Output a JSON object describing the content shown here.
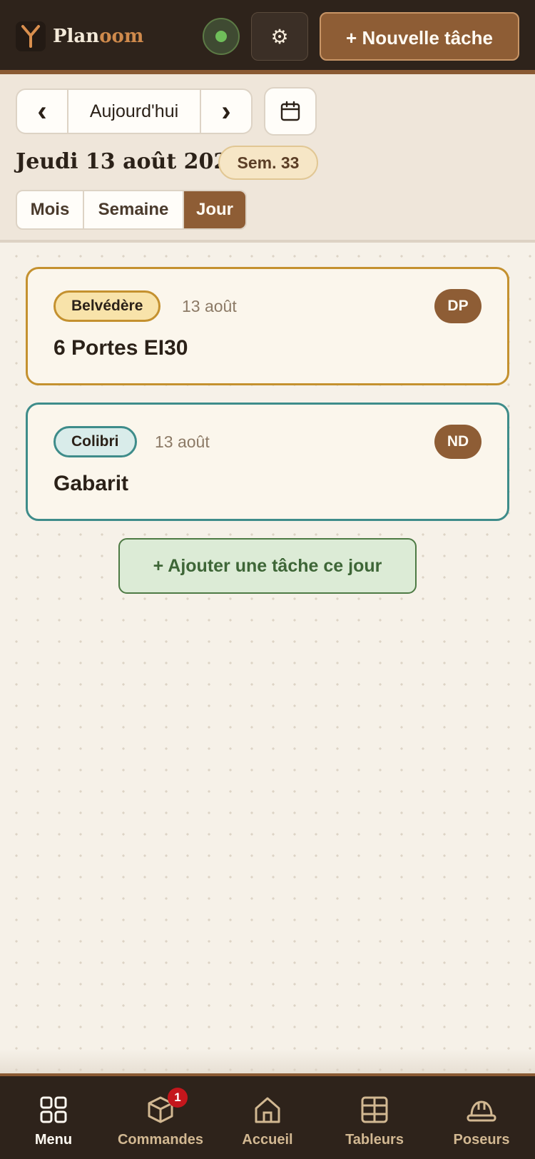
{
  "colors": {
    "brand": "#8e5d35",
    "topbar": "#2e231b",
    "status_ok": "#6fbe5a",
    "tag_belvedere": "#c4912f",
    "tag_colibri": "#3e8c8a",
    "add_task": "#4d7a44",
    "badge": "#c4161c"
  },
  "header": {
    "logo_icon": "y-fork-logo-icon",
    "logo_part1": "Plan",
    "logo_part2": "oom",
    "status_icon": "status-online-dot-icon",
    "settings_icon": "⚙",
    "new_task_label": "+ Nouvelle tâche"
  },
  "date_nav": {
    "prev_label": "‹",
    "today_label": "Aujourd'hui",
    "next_label": "›",
    "calendar_icon": "calendar-icon",
    "current_date": "Jeudi 13 août 2026",
    "week_badge": "Sem. 33"
  },
  "view_switch": {
    "month": "Mois",
    "week": "Semaine",
    "day": "Jour",
    "selected": "Jour"
  },
  "tasks": [
    {
      "tag": "Belvédère",
      "date": "13 août",
      "avatar": "DP",
      "title": "6 Portes EI30"
    },
    {
      "tag": "Colibri",
      "date": "13 août",
      "avatar": "ND",
      "title": "Gabarit"
    }
  ],
  "add_task_day_label": "+ Ajouter une tâche ce jour",
  "bottom_nav": [
    {
      "label": "Menu",
      "icon": "grid-icon",
      "active": true
    },
    {
      "label": "Commandes",
      "icon": "box-icon",
      "badge": "1"
    },
    {
      "label": "Accueil",
      "icon": "home-icon"
    },
    {
      "label": "Tableurs",
      "icon": "table-icon"
    },
    {
      "label": "Poseurs",
      "icon": "hard-hat-icon"
    }
  ]
}
